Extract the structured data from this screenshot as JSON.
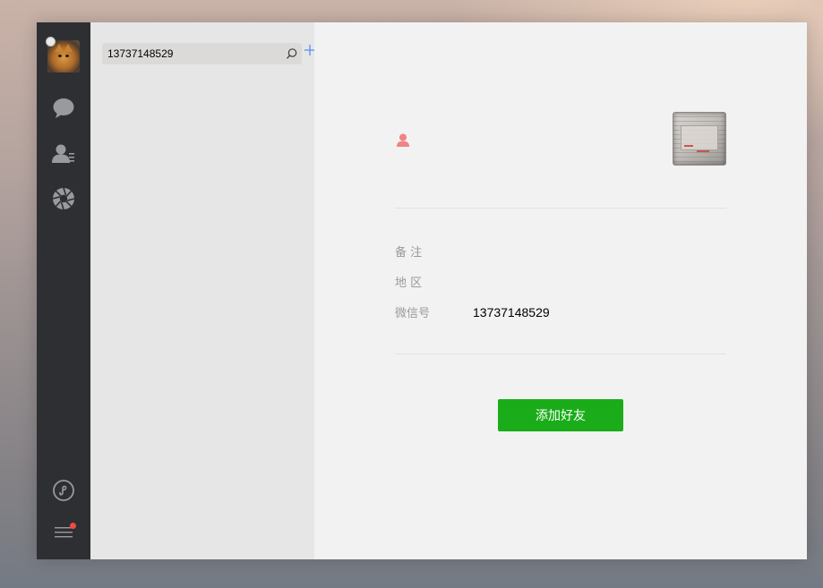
{
  "nav": {
    "items": [
      {
        "name": "chat",
        "icon": "chat-bubble-icon"
      },
      {
        "name": "contacts",
        "icon": "contacts-icon"
      },
      {
        "name": "moments",
        "icon": "aperture-icon"
      }
    ],
    "bottom_items": [
      {
        "name": "mini-programs",
        "icon": "mini-program-icon"
      },
      {
        "name": "menu",
        "icon": "hamburger-menu-icon",
        "has_badge": true
      }
    ],
    "colors": {
      "bar_bg": "#2e2f33",
      "icon": "#9a9a9c",
      "badge": "#f24a43"
    }
  },
  "search": {
    "value": "13737148529",
    "icon": "search-icon",
    "add_icon": "plus-icon"
  },
  "profile": {
    "gender_icon": "person-icon",
    "gender_color": "#f08483",
    "fields": [
      {
        "label": "备 注",
        "value": ""
      },
      {
        "label": "地 区",
        "value": ""
      },
      {
        "label": "微信号",
        "value": "13737148529"
      }
    ],
    "add_button_label": "添加好友",
    "accent_color": "#1aad19"
  }
}
